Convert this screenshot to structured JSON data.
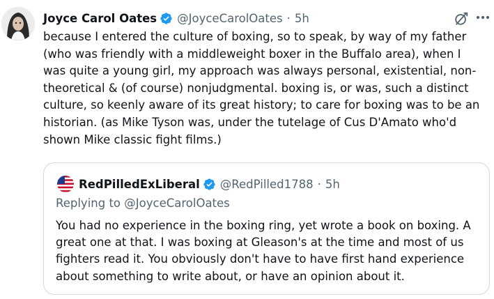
{
  "colors": {
    "accent": "#1d9bf0",
    "muted": "#536471",
    "border": "#cfd9de",
    "text": "#0f1419"
  },
  "tweet": {
    "author_name": "Joyce Carol Oates",
    "handle": "@JoyceCarolOates",
    "separator": "·",
    "time": "5h",
    "lines": [
      "because I entered the culture of boxing, so to speak, by way of my father",
      "(who was friendly with a middleweight boxer in the Buffalo area), when I",
      "was quite a young girl, my approach was always personal, existential, non-",
      "theoretical & (of course) nonjudgmental. boxing is, or was, such a distinct",
      "culture, so keenly aware of its great history; to care for boxing was to be an",
      "historian. (as Mike Tyson was, under the tutelage of Cus D'Amato who'd",
      "shown Mike classic fight films.)"
    ]
  },
  "quoted": {
    "author_name": "RedPilledExLiberal",
    "handle": "@RedPilled1788",
    "separator": "·",
    "time": "5h",
    "replying_prefix": "Replying to",
    "replying_to": "@JoyceCarolOates",
    "lines": [
      "You had no experience in the boxing ring, yet wrote a book on boxing. A",
      "great one at that. I was boxing at Gleason's at the time and most of us",
      "fighters read it. You obviously don't have to have first hand experience",
      "about something to write about, or have an opinion about it."
    ]
  },
  "icons": {
    "grok": "grok-icon",
    "more": "more-icon",
    "verified": "verified-badge-icon"
  }
}
